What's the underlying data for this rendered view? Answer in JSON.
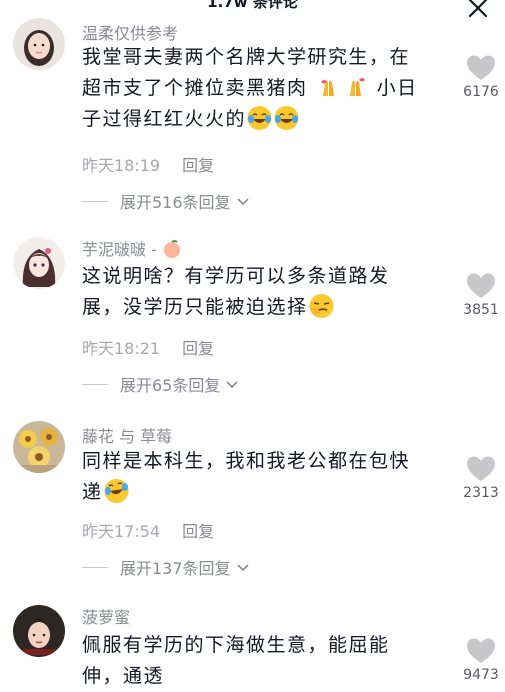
{
  "header": {
    "title": "1.7w 条评论"
  },
  "comments": [
    {
      "username": "温柔仅供参考",
      "text_parts": [
        "我堂哥夫妻两个名牌大学研究生，在超市支了个摊位卖黑猪肉",
        "小日子过得红红火火的"
      ],
      "time": "昨天18:19",
      "reply": "回复",
      "expand": "展开516条回复",
      "likes": "6176"
    },
    {
      "username": "芋泥啵啵 -",
      "text_parts": [
        "这说明啥？有学历可以多条道路发展，没学历只能被迫选择"
      ],
      "time": "昨天18:21",
      "reply": "回复",
      "expand": "展开65条回复",
      "likes": "3851"
    },
    {
      "username": "藤花 与 草莓",
      "text_parts": [
        "同样是本科生，我和我老公都在包快递"
      ],
      "time": "昨天17:54",
      "reply": "回复",
      "expand": "展开137条回复",
      "likes": "2313"
    },
    {
      "username": "菠萝蜜",
      "text_parts": [
        "佩服有学历的下海做生意，能屈能伸，通透"
      ],
      "likes": "9473"
    }
  ],
  "icons": {
    "close": "close-icon",
    "like": "heart-icon",
    "expand": "chevron-down-icon",
    "emojis": [
      "pray-hands-emoji",
      "laugh-cry-emoji",
      "peach-emoji",
      "smirk-emoji"
    ]
  },
  "colors": {
    "like_heart": "#c7c7c9",
    "meta_text": "#a8a9ae"
  }
}
